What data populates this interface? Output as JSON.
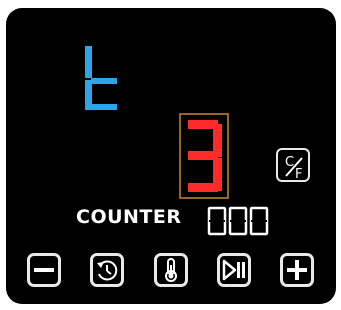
{
  "display": {
    "time_digit": "t",
    "time_color": "#2ea6e6",
    "level_digit": "3",
    "level_color": "#ff2b2b",
    "level_highlight_color": "#c68a2a",
    "segment_outline_color": "#ffffff"
  },
  "unit_toggle": {
    "top": "C",
    "bottom": "F",
    "icon": "celsius-fahrenheit-icon"
  },
  "counter": {
    "label": "COUNTER",
    "value": "000"
  },
  "controls": [
    {
      "name": "decrease",
      "icon": "minus-icon"
    },
    {
      "name": "timer",
      "icon": "clock-arrow-icon"
    },
    {
      "name": "temperature",
      "icon": "thermometer-icon"
    },
    {
      "name": "play-pause",
      "icon": "play-pause-icon"
    },
    {
      "name": "increase",
      "icon": "plus-icon"
    }
  ]
}
